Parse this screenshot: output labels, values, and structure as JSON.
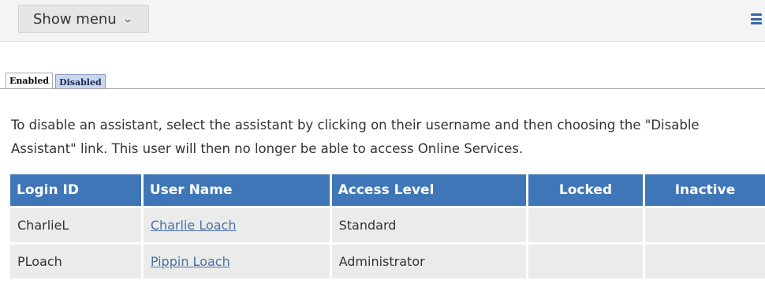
{
  "header": {
    "menu_button_label": "Show menu",
    "menu_button_icon": "chevron-down-icon",
    "hamburger_icon": "hamburger-menu-icon",
    "hamburger_color": "#3a66a8"
  },
  "tabs": [
    {
      "label": "Enabled",
      "active": true
    },
    {
      "label": "Disabled",
      "active": false
    }
  ],
  "instructions": "To disable an assistant, select the assistant by clicking on their username and then choosing the \"Disable Assistant\" link. This user will then no longer be able to access Online Services.",
  "table": {
    "header_color": "#3f76b8",
    "columns": [
      "Login ID",
      "User Name",
      "Access Level",
      "Locked",
      "Inactive"
    ],
    "rows": [
      {
        "login_id": "CharlieL",
        "user_name": "Charlie Loach",
        "access_level": "Standard",
        "locked": "",
        "inactive": ""
      },
      {
        "login_id": "PLoach",
        "user_name": "Pippin Loach",
        "access_level": "Administrator",
        "locked": "",
        "inactive": ""
      }
    ]
  }
}
